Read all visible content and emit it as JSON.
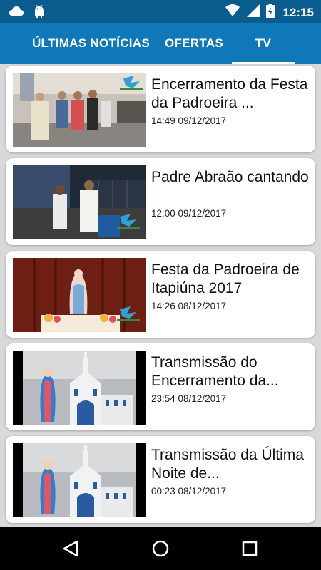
{
  "status_bar": {
    "time": "12:15",
    "left_icons": [
      "cloud-icon",
      "android-icon"
    ],
    "right_icons": [
      "wifi-icon",
      "signal-icon",
      "battery-icon"
    ]
  },
  "tabs": [
    {
      "label": "ÚLTIMAS NOTÍCIAS",
      "active": false
    },
    {
      "label": "OFERTAS",
      "active": false
    },
    {
      "label": "TV",
      "active": true
    }
  ],
  "videos": [
    {
      "title": "Encerramento da Festa da Padroeira ...",
      "date": "14:49 09/12/2017",
      "thumbnail": "church-interior"
    },
    {
      "title": "Padre Abraão cantando",
      "date": "12:00 09/12/2017",
      "thumbnail": "priest-singing"
    },
    {
      "title": "Festa da Padroeira de Itapiúna 2017",
      "date": "14:26 08/12/2017",
      "thumbnail": "virgin-statue"
    },
    {
      "title": "Transmissão do Encerramento da...",
      "date": "23:54 08/12/2017",
      "thumbnail": "church-facade"
    },
    {
      "title": "Transmissão da Última Noite de...",
      "date": "00:23 08/12/2017",
      "thumbnail": "church-facade"
    }
  ],
  "nav_bar": {
    "buttons": [
      "back-icon",
      "home-icon",
      "recents-icon"
    ]
  },
  "colors": {
    "status_bar": "#0a5c8f",
    "tab_bar": "#0f78b8",
    "background": "#d9d9d9"
  }
}
